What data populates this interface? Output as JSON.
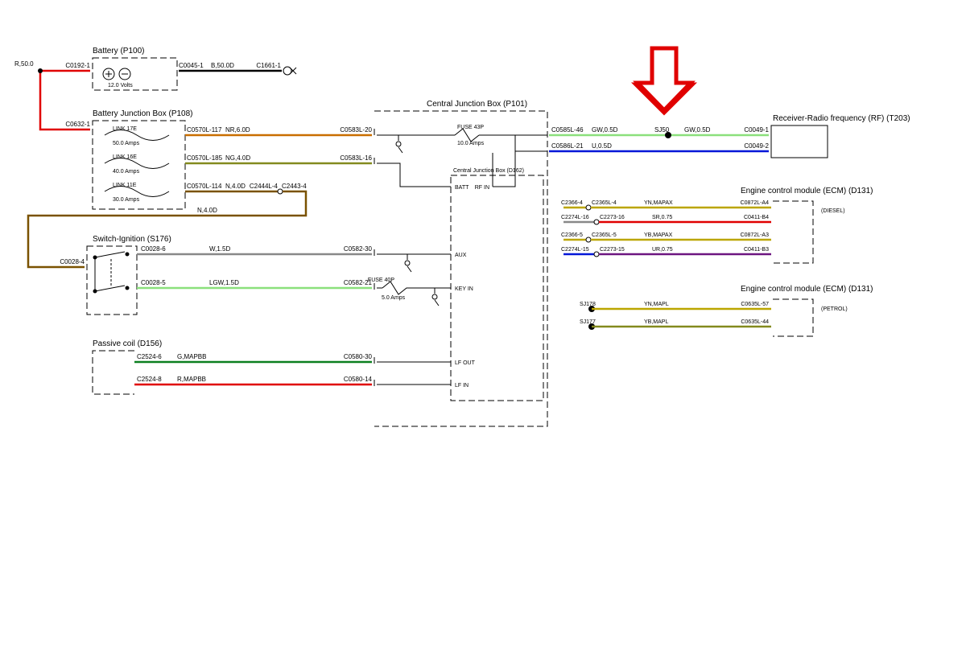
{
  "components": {
    "battery": {
      "title": "Battery (P100)",
      "volts": "12.0 Volts"
    },
    "bjb": {
      "title": "Battery Junction Box (P108)"
    },
    "cjb": {
      "title": "Central Junction Box (P101)",
      "inner": "Central Junction Box (D162)"
    },
    "ignition": {
      "title": "Switch-Ignition (S176)"
    },
    "passive": {
      "title": "Passive coil (D156)"
    },
    "receiver": {
      "title": "Receiver-Radio frequency (RF) (T203)"
    },
    "ecmDiesel": {
      "title": "Engine control module (ECM) (D131)",
      "note": "(DIESEL)"
    },
    "ecmPetrol": {
      "title": "Engine control module (ECM) (D131)",
      "note": "(PETROL)"
    }
  },
  "links": {
    "l17": {
      "name": "LINK 17E",
      "amps": "50.0 Amps"
    },
    "l16": {
      "name": "LINK 16E",
      "amps": "40.0 Amps"
    },
    "l11": {
      "name": "LINK 11E",
      "amps": "30.0 Amps"
    }
  },
  "fuses": {
    "f43": {
      "name": "FUSE 43P",
      "amps": "10.0 Amps"
    },
    "f40": {
      "name": "FUSE 40P",
      "amps": "5.0 Amps"
    }
  },
  "conn": {
    "c0192_1": "C0192-1",
    "c0045_1": "C0045-1",
    "c1661_1": "C1661-1",
    "c0632_1": "C0632-1",
    "c0570_117": "C0570L-117",
    "c0583_20": "C0583L-20",
    "c0570_185": "C0570L-185",
    "c0583_16": "C0583L-16",
    "c0570_114": "C0570L-114",
    "c2444_4": "C2444L-4",
    "c2443_4": "C2443-4",
    "c0028_4": "C0028-4",
    "c0028_6": "C0028-6",
    "c0028_5": "C0028-5",
    "c0582_30": "C0582-30",
    "c0582_21": "C0582-21",
    "c2524_6": "C2524-6",
    "c0580_30": "C0580-30",
    "c2524_8": "C2524-8",
    "c0580_14": "C0580-14",
    "c0585_46": "C0585L-46",
    "c0586_21": "C0586L-21",
    "c0049_1": "C0049-1",
    "c0049_2": "C0049-2",
    "c2366_4": "C2366-4",
    "c2365_4": "C2365L-4",
    "c0872_a4": "C0872L-A4",
    "c2274_16": "C2274L-16",
    "c2273_16": "C2273-16",
    "c0411_b4": "C0411-B4",
    "c2366_5": "C2366-5",
    "c2365_5": "C2365L-5",
    "c0872_a3": "C0872L-A3",
    "c2274_15": "C2274L-15",
    "c2273_15": "C2273-15",
    "c0411_b3": "C0411-B3",
    "sj178": "SJ178",
    "c0635_57": "C0635L-57",
    "sj177": "SJ177",
    "c0635_44": "C0635L-44",
    "sj50": "SJ50"
  },
  "wireLbl": {
    "r50": "R,50.0",
    "b50d": "B,50.0D",
    "nr6": "NR,6.0D",
    "ng4": "NG,4.0D",
    "n4": "N,4.0D",
    "n4b": "N,4.0D",
    "w15": "W,1.5D",
    "lgw15": "LGW,1.5D",
    "gmap": "G,MAPBB",
    "rmap": "R,MAPBB",
    "gw05": "GW,0.5D",
    "gw05b": "GW,0.5D",
    "u05d": "U,0.5D",
    "ynx": "YN,MAPAX",
    "sr075": "SR,0.75",
    "ybx": "YB,MAPAX",
    "ur075": "UR,0.75",
    "ynl": "YN,MAPL",
    "ybl": "YB,MAPL"
  },
  "tags": {
    "batt": "BATT",
    "rfin": "RF IN",
    "aux": "AUX",
    "keyin": "KEY IN",
    "lfout": "LF OUT",
    "lfin": "LF IN"
  }
}
